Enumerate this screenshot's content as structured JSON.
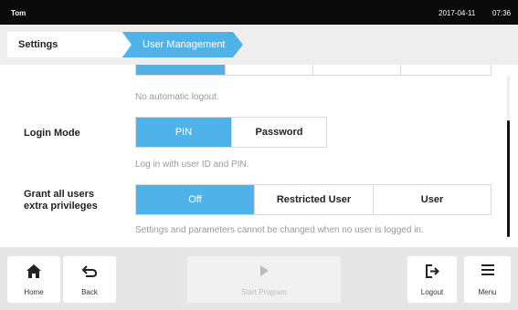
{
  "status_bar": {
    "user": "Tom",
    "date": "2017-04-11",
    "time": "07:36"
  },
  "breadcrumb": {
    "items": [
      {
        "label": "Settings"
      },
      {
        "label": "User Management"
      }
    ]
  },
  "settings": {
    "logout_hint": "No automatic logout.",
    "login_mode": {
      "label": "Login Mode",
      "options": [
        "PIN",
        "Password"
      ],
      "selected": "PIN",
      "hint": "Log in with user ID and PIN."
    },
    "extra_privileges": {
      "label_line1": "Grant all users",
      "label_line2": "extra privileges",
      "options": [
        "Off",
        "Restricted User",
        "User"
      ],
      "selected": "Off",
      "hint": "Settings and parameters cannot be changed when no user is logged in."
    }
  },
  "footer": {
    "home": {
      "label": "Home",
      "icon": "home-icon"
    },
    "back": {
      "label": "Back",
      "icon": "back-arrow-icon"
    },
    "start_program": {
      "label": "Start Program",
      "icon": "play-icon",
      "enabled": false
    },
    "logout": {
      "label": "Logout",
      "icon": "logout-icon"
    },
    "menu": {
      "label": "Menu",
      "icon": "menu-icon"
    }
  },
  "colors": {
    "accent": "#4fb3ea",
    "statusbar": "#0a0a0a",
    "footer_bg": "#e6e6e6",
    "hint_text": "#999999"
  }
}
